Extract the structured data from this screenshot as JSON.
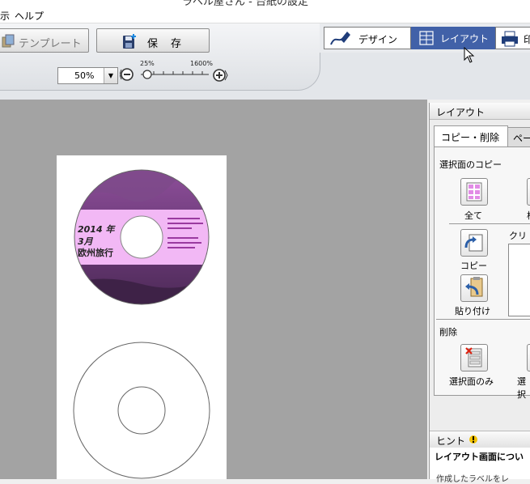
{
  "window": {
    "title": "ラベル屋さん - 台紙の設定"
  },
  "menu": {
    "items": [
      "示",
      "ヘルプ"
    ]
  },
  "toolbar": {
    "template_label": "テンプレート",
    "save_label": "保存",
    "zoom_value": "50%",
    "zoom_min": "25%",
    "zoom_max": "1600%",
    "zoom_level": 0.0
  },
  "modes": {
    "design": "デザイン",
    "layout": "レイアウト",
    "print": "印",
    "active": "layout"
  },
  "disc": {
    "line1": "2014 年",
    "line2": "3月",
    "line3": "欧州旅行"
  },
  "panel": {
    "title": "レイアウト",
    "tabs": [
      "コピー・削除",
      "ペー"
    ],
    "copy_section": "選択面のコピー",
    "all_label": "全て",
    "partial_label": "枠",
    "copy_label": "コピー",
    "paste_label": "貼り付け",
    "clipboard_label": "クリッ",
    "delete_section": "削除",
    "delete_selected_label": "選択面のみ",
    "delete_other_label": "選択",
    "hint_title": "ヒント",
    "hint_heading": "レイアウト画面につい",
    "hint_text": "作成したラベルをレ"
  },
  "colors": {
    "accent": "#4161a8",
    "canvas": "#a3a3a3",
    "disc_band": "#f2b8f5"
  }
}
